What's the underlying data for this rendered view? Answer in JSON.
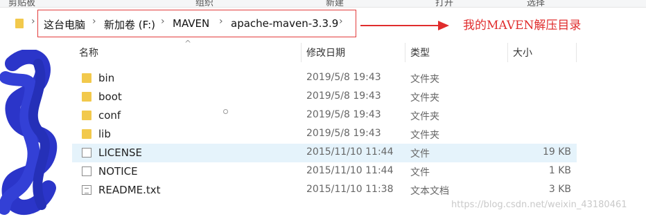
{
  "ribbon": {
    "groups": [
      "剪贴板",
      "组织",
      "新建",
      "打开",
      "选择"
    ]
  },
  "address_bar": {
    "breadcrumbs": [
      "这台电脑",
      "新加卷 (F:)",
      "MAVEN",
      "apache-maven-3.3.9"
    ]
  },
  "annotation": {
    "text": "我的MAVEN解压目录",
    "color": "#e02d2d"
  },
  "columns": {
    "name": "名称",
    "date": "修改日期",
    "type": "类型",
    "size": "大小"
  },
  "files": [
    {
      "name": "bin",
      "date": "2019/5/8 19:43",
      "type": "文件夹",
      "size": "",
      "icon": "folder-icon"
    },
    {
      "name": "boot",
      "date": "2019/5/8 19:43",
      "type": "文件夹",
      "size": "",
      "icon": "folder-icon"
    },
    {
      "name": "conf",
      "date": "2019/5/8 19:43",
      "type": "文件夹",
      "size": "",
      "icon": "folder-icon"
    },
    {
      "name": "lib",
      "date": "2019/5/8 19:43",
      "type": "文件夹",
      "size": "",
      "icon": "folder-icon"
    },
    {
      "name": "LICENSE",
      "date": "2015/11/10 11:44",
      "type": "文件",
      "size": "19 KB",
      "icon": "file-icon"
    },
    {
      "name": "NOTICE",
      "date": "2015/11/10 11:44",
      "type": "文件",
      "size": "1 KB",
      "icon": "file-icon"
    },
    {
      "name": "README.txt",
      "date": "2015/11/10 11:38",
      "type": "文本文档",
      "size": "3 KB",
      "icon": "text-file-icon"
    }
  ],
  "watermark": "https://blog.csdn.net/weixin_43180461"
}
